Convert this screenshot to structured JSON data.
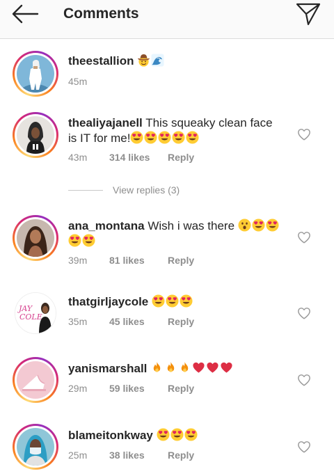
{
  "header": {
    "title": "Comments"
  },
  "comments": [
    {
      "username": "theestallion",
      "text": "",
      "time": "45m",
      "likes": "",
      "reply": ""
    },
    {
      "username": "thealiyajanell",
      "text": "This squeaky clean face is IT for me!",
      "time": "43m",
      "likes": "314 likes",
      "reply": "Reply"
    },
    {
      "username": "ana_montana",
      "text": "Wish i was there",
      "time": "39m",
      "likes": "81 likes",
      "reply": "Reply"
    },
    {
      "username": "thatgirljaycole",
      "text": "",
      "time": "35m",
      "likes": "45 likes",
      "reply": "Reply"
    },
    {
      "username": "yanismarshall",
      "text": "",
      "time": "29m",
      "likes": "59 likes",
      "reply": "Reply"
    },
    {
      "username": "blameitonkway",
      "text": "",
      "time": "25m",
      "likes": "38 likes",
      "reply": "Reply"
    }
  ],
  "view_replies": {
    "label": "View replies (3)"
  },
  "avatar_text": {
    "jaycole": "JAY COLE"
  },
  "icons": {
    "back": "back-arrow-icon",
    "send": "paper-plane-icon",
    "like": "heart-outline-icon",
    "emoji": [
      "cowboy-face-emoji",
      "water-wave-emoji",
      "heart-eyes-emoji",
      "hushed-face-emoji",
      "fire-emoji",
      "red-heart-emoji"
    ]
  },
  "colors": {
    "meta_text": "#8e8e8e",
    "text": "#262626",
    "header_bg": "#fafafa",
    "emoji_heart": "#e0245e"
  }
}
